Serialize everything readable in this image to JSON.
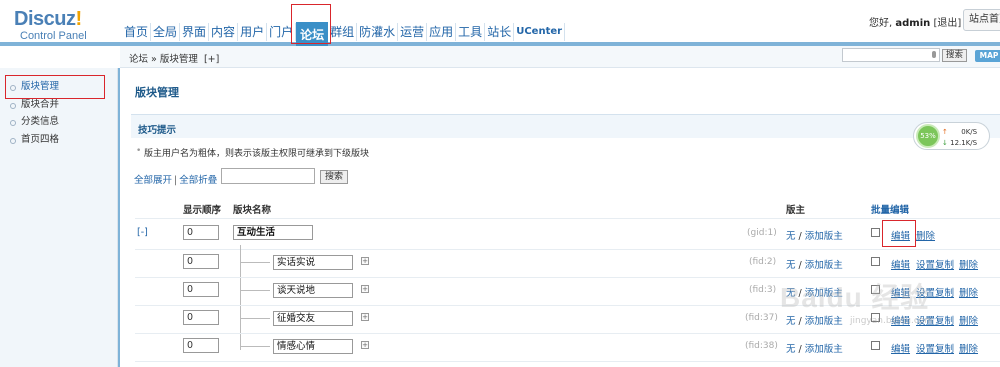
{
  "header": {
    "logo_main": "Discuz",
    "logo_mark": "!",
    "logo_sub": "Control Panel",
    "nav": [
      "首页",
      "全局",
      "界面",
      "内容",
      "用户",
      "门户",
      "论坛",
      "群组",
      "防灌水",
      "运营",
      "应用",
      "工具",
      "站长",
      "UCenter"
    ],
    "active_nav": "论坛",
    "greeting": "您好,",
    "username": "admin",
    "logout": "[退出]",
    "site_home": "站点首页"
  },
  "subbar": {
    "breadcrumb_root": "论坛",
    "breadcrumb_sep": " » ",
    "breadcrumb_current": "版块管理",
    "breadcrumb_add": "[+]",
    "search_button": "搜索",
    "map_button": "MAP"
  },
  "sidebar": {
    "items": [
      {
        "label": "版块管理",
        "active": true
      },
      {
        "label": "版块合并",
        "active": false
      },
      {
        "label": "分类信息",
        "active": false
      },
      {
        "label": "首页四格",
        "active": false
      }
    ]
  },
  "main": {
    "page_title": "版块管理",
    "tips_title": "技巧提示",
    "tip": "版主用户名为粗体，则表示该版主权限可继承到下级版块",
    "expand_all": "全部展开",
    "collapse_all": "全部折叠",
    "toolbar_sep": "|",
    "search_button": "搜索",
    "columns": {
      "order": "显示顺序",
      "name": "版块名称",
      "moderator": "版主",
      "batch": "批量编辑"
    },
    "group_row": {
      "expander": "[-]",
      "order": "0",
      "name": "互动生活",
      "id_label": "(gid:1)",
      "moderator_none": "无",
      "moderator_sep": " / ",
      "moderator_add": "添加版主",
      "edit": "编辑",
      "delete": "删除"
    },
    "forum_rows": [
      {
        "order": "0",
        "name": "实话实说",
        "id_label": "(fid:2)",
        "moderator_none": "无",
        "moderator_sep": " / ",
        "moderator_add": "添加版主",
        "edit": "编辑",
        "copy": "设置复制",
        "delete": "删除"
      },
      {
        "order": "0",
        "name": "谈天说地",
        "id_label": "(fid:3)",
        "moderator_none": "无",
        "moderator_sep": " / ",
        "moderator_add": "添加版主",
        "edit": "编辑",
        "copy": "设置复制",
        "delete": "删除"
      },
      {
        "order": "0",
        "name": "征婚交友",
        "id_label": "(fid:37)",
        "moderator_none": "无",
        "moderator_sep": " / ",
        "moderator_add": "添加版主",
        "edit": "编辑",
        "copy": "设置复制",
        "delete": "删除"
      },
      {
        "order": "0",
        "name": "情感心情",
        "id_label": "(fid:38)",
        "moderator_none": "无",
        "moderator_sep": " / ",
        "moderator_add": "添加版主",
        "edit": "编辑",
        "copy": "设置复制",
        "delete": "删除"
      }
    ]
  },
  "net_widget": {
    "percent": "53%",
    "upload": "0K/S",
    "download": "12.1K/S"
  },
  "watermark": {
    "text": "Baidu 经验",
    "url": "jingyan.baidu.com"
  },
  "colors": {
    "accent": "#3a8fc7",
    "link": "#2366a8",
    "highlight": "#d9262c"
  }
}
